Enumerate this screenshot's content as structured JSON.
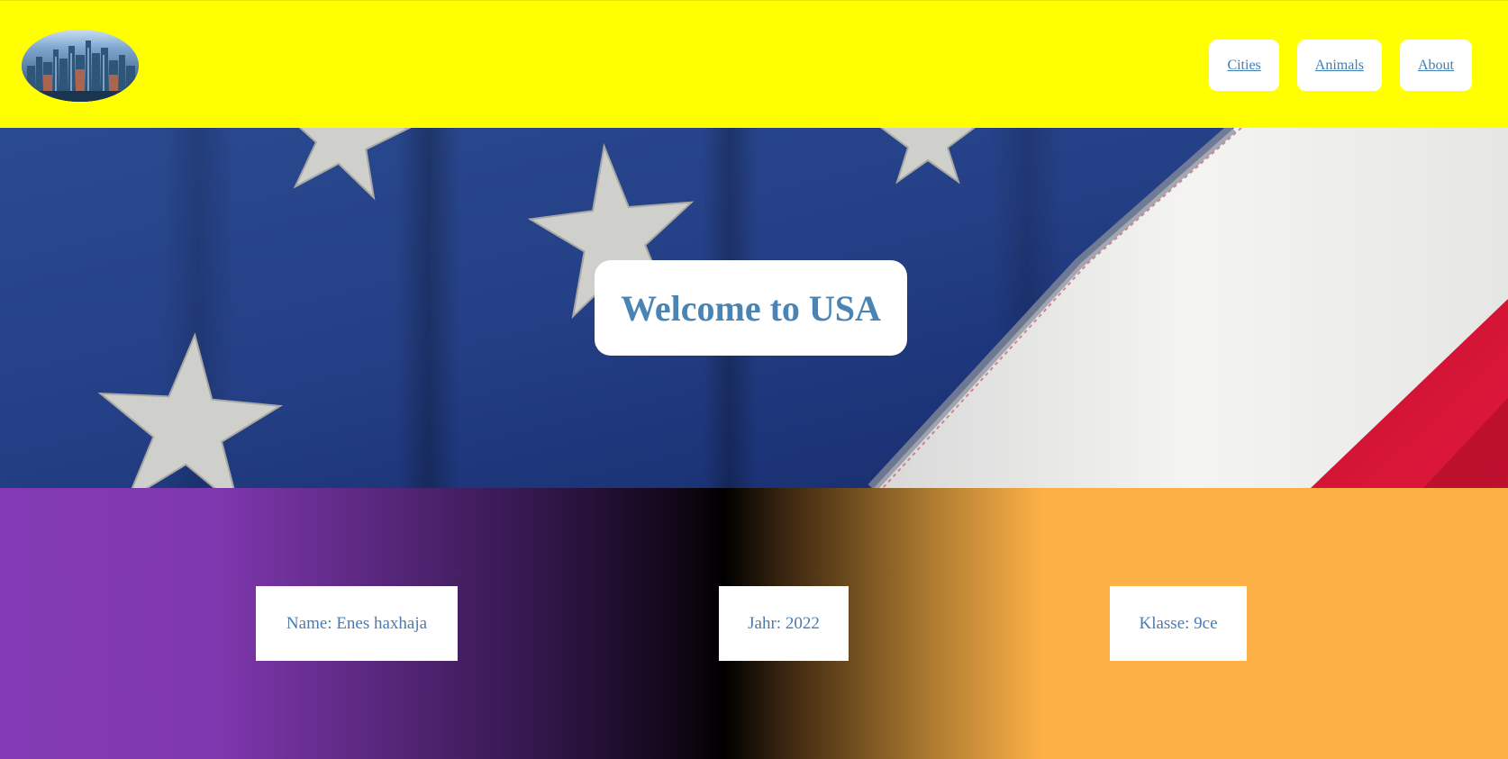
{
  "header": {
    "logo_icon": "city-skyline-logo",
    "nav": [
      {
        "label": "Cities"
      },
      {
        "label": "Animals"
      },
      {
        "label": "About"
      }
    ],
    "background_color": "#ffff00",
    "link_color": "#3f7eb5"
  },
  "hero": {
    "image": "american-flag-stars-stripes",
    "title": "Welcome to USA",
    "title_color": "#4a84b4"
  },
  "info": {
    "name": "Name: Enes haxhaja",
    "year": "Jahr: 2022",
    "class": "Klasse: 9ce",
    "gradient_colors": [
      "#833ab4",
      "#000000",
      "#fcb045"
    ],
    "text_color": "#4a7bb0"
  }
}
